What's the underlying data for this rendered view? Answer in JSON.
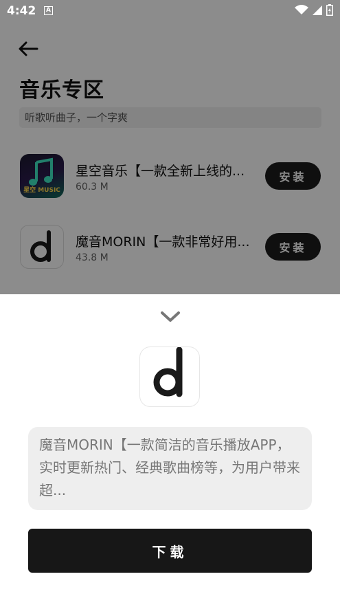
{
  "status_bar": {
    "time": "4:42",
    "notification_icon_letter": "A",
    "icons": [
      "wifi-icon",
      "signal-icon",
      "battery-icon"
    ]
  },
  "page": {
    "back_icon": "arrow-left-icon",
    "title": "音乐专区",
    "subtitle": "听歌听曲子，一个字爽",
    "apps": [
      {
        "name": "星空音乐【一款全新上线的...",
        "size": "60.3 M",
        "install_label": "安装",
        "icon_text": "星空 MUSIC"
      },
      {
        "name": "魔音MORIN【一款非常好用...",
        "size": "43.8 M",
        "install_label": "安装"
      }
    ]
  },
  "sheet": {
    "collapse_icon": "chevron-down-icon",
    "description": "魔音MORIN【一款简洁的音乐播放APP，实时更新热门、经典歌曲榜等，为用户带来超...",
    "download_label": "下载"
  },
  "colors": {
    "overlay": "#000000",
    "button_dark": "#1d1d1d",
    "sheet_bg": "#ffffff",
    "desc_bg": "#eeeeee"
  }
}
